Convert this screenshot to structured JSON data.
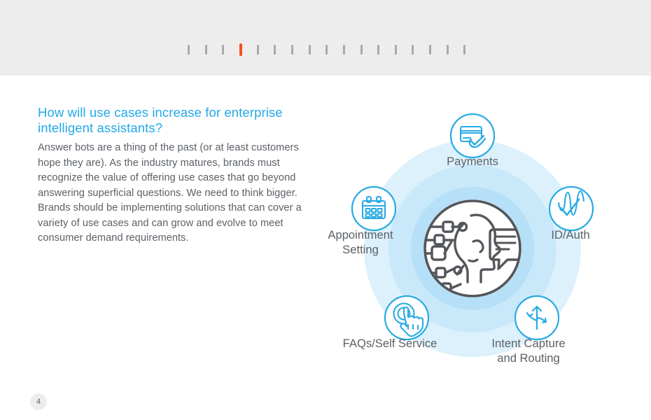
{
  "header": {
    "progress": {
      "total_ticks": 17,
      "active_index": 4,
      "active_color": "#f6501e",
      "inactive_color": "#a8a8ad",
      "band_color": "#ededed"
    }
  },
  "content": {
    "headline": "How will use cases increase for enterprise intelligent assistants?",
    "headline_color": "#23a9e8",
    "body": "Answer bots are a thing of the past (or at least customers hope they are). As the industry matures, brands must recognize the value of offering use cases that go beyond answering superficial questions. We need to think bigger. Brands should be implementing solutions that can cover a variety of use cases and can grow and evolve to meet consumer demand requirements.",
    "body_color": "#5b6066"
  },
  "diagram": {
    "accent_color": "#29abe2",
    "ring_colors": [
      "#daf0fb",
      "#c8e8f9",
      "#b3dff6"
    ],
    "center": {
      "icon": "ai-brain-head-chat-icon",
      "stroke": "#53565a"
    },
    "nodes": [
      {
        "id": "payments",
        "label": "Payments",
        "icon": "credit-card-check-icon"
      },
      {
        "id": "appointment",
        "label": "Appointment\nSetting",
        "icon": "calendar-icon"
      },
      {
        "id": "idauth",
        "label": "ID/Auth",
        "icon": "voice-waveform-check-icon"
      },
      {
        "id": "faqs",
        "label": "FAQs/Self Service",
        "icon": "touch-hand-tap-icon"
      },
      {
        "id": "intent",
        "label": "Intent Capture\nand Routing",
        "icon": "branching-arrows-icon"
      }
    ]
  },
  "footer": {
    "page_number": "4"
  }
}
